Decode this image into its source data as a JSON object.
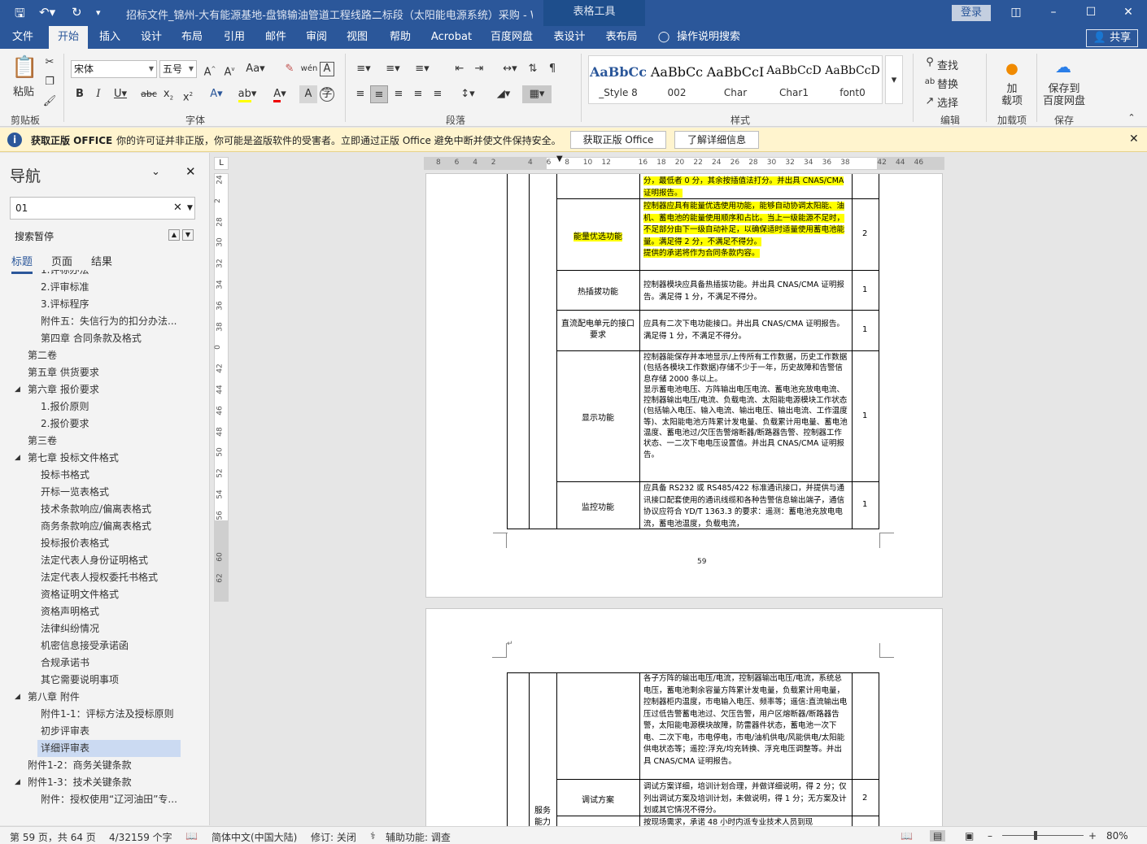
{
  "titlebar": {
    "document_title": "招标文件_锦州-大有能源基地-盘锦输油管道工程线路二标段（太阳能电源系统）采购 - W...",
    "context_tab": "表格工具",
    "login_label": "登录"
  },
  "tabs": [
    "文件",
    "开始",
    "插入",
    "设计",
    "布局",
    "引用",
    "邮件",
    "审阅",
    "视图",
    "帮助",
    "Acrobat",
    "百度网盘",
    "表设计",
    "表布局"
  ],
  "active_tab": "开始",
  "tell_me": "操作说明搜索",
  "share_label": "共享",
  "ribbon": {
    "clipboard": {
      "paste": "粘贴",
      "label": "剪贴板"
    },
    "font": {
      "name": "宋体",
      "size": "五号",
      "label": "字体"
    },
    "paragraph": {
      "label": "段落"
    },
    "styles": {
      "label": "样式",
      "items": [
        {
          "preview": "AaBbCc",
          "name": "_Style 8",
          "accent": "#2b579a"
        },
        {
          "preview": "AaBbCc",
          "name": "002",
          "accent": "#111111"
        },
        {
          "preview": "AaBbCcI",
          "name": "Char",
          "accent": "#111111"
        },
        {
          "preview": "AaBbCcD",
          "name": "Char1",
          "accent": "#111111"
        },
        {
          "preview": "AaBbCcD",
          "name": "font0",
          "accent": "#111111"
        }
      ]
    },
    "editing": {
      "find": "查找",
      "replace": "替换",
      "select": "选择",
      "label": "编辑"
    },
    "addins": {
      "load": "加\n载项",
      "label": "加载项"
    },
    "save": {
      "save_to": "保存到\n百度网盘",
      "label": "保存"
    }
  },
  "notification": {
    "title": "获取正版 OFFICE",
    "message": "你的许可证并非正版，你可能是盗版软件的受害者。立即通过正版 Office 避免中断并使文件保持安全。",
    "btn_get": "获取正版 Office",
    "btn_learn": "了解详细信息"
  },
  "nav": {
    "title": "导航",
    "search_value": "01",
    "search_paused": "搜索暂停",
    "tabs": [
      "标题",
      "页面",
      "结果"
    ],
    "items": [
      {
        "text": "1.评标办法",
        "indent": 2
      },
      {
        "text": "2.评审标准",
        "indent": 2
      },
      {
        "text": "3.评标程序",
        "indent": 2
      },
      {
        "text": "附件五：失信行为的扣分办法...",
        "indent": 2
      },
      {
        "text": "第四章  合同条款及格式",
        "indent": 2
      },
      {
        "text": "第二卷",
        "indent": 1
      },
      {
        "text": "第五章  供货要求",
        "indent": 1
      },
      {
        "text": "第六章  报价要求",
        "indent": 1,
        "arrow": true
      },
      {
        "text": "1.报价原则",
        "indent": 2
      },
      {
        "text": "2.报价要求",
        "indent": 2
      },
      {
        "text": "第三卷",
        "indent": 1
      },
      {
        "text": "第七章  投标文件格式",
        "indent": 1,
        "arrow": true
      },
      {
        "text": "投标书格式",
        "indent": 2
      },
      {
        "text": "开标一览表格式",
        "indent": 2
      },
      {
        "text": "技术条款响应/偏离表格式",
        "indent": 2
      },
      {
        "text": "商务条款响应/偏离表格式",
        "indent": 2
      },
      {
        "text": "投标报价表格式",
        "indent": 2
      },
      {
        "text": "法定代表人身份证明格式",
        "indent": 2
      },
      {
        "text": "法定代表人授权委托书格式",
        "indent": 2
      },
      {
        "text": "资格证明文件格式",
        "indent": 2
      },
      {
        "text": "资格声明格式",
        "indent": 2
      },
      {
        "text": "法律纠纷情况",
        "indent": 2
      },
      {
        "text": "机密信息接受承诺函",
        "indent": 2
      },
      {
        "text": "合规承诺书",
        "indent": 2
      },
      {
        "text": "其它需要说明事项",
        "indent": 2
      },
      {
        "text": "第八章  附件",
        "indent": 1,
        "arrow": true
      },
      {
        "text": "附件1-1：评标方法及授标原则",
        "indent": 2
      },
      {
        "text": "初步评审表",
        "indent": 2
      },
      {
        "text": "详细评审表",
        "indent": 2,
        "selected": true
      },
      {
        "text": "附件1-2：商务关键条款",
        "indent": 1
      },
      {
        "text": "附件1-3：技术关键条款",
        "indent": 1,
        "arrow": true
      },
      {
        "text": "附件：授权使用“辽河油田”专...",
        "indent": 2
      }
    ]
  },
  "ruler": {
    "h_numbers": [
      "8",
      "6",
      "4",
      "2",
      "",
      "4",
      "6",
      "8",
      "10",
      "12",
      "",
      "16",
      "18",
      "20",
      "22",
      "24",
      "26",
      "28",
      "30",
      "32",
      "34",
      "36",
      "38",
      "",
      "42",
      "44",
      "46"
    ],
    "v_numbers": [
      "24",
      "2",
      "28",
      "30",
      "32",
      "34",
      "36",
      "38",
      "0",
      "42",
      "44",
      "46",
      "48",
      "50",
      "52",
      "54",
      "56",
      "",
      "60",
      "62"
    ]
  },
  "page1": {
    "top_cont": "分，最低者 0 分，其余按插值法打分。并出具 CNAS/CMA 证明报告。",
    "rows": [
      {
        "label": "能量优选功能",
        "text": "控制器应具有能量优选使用功能，能够自动协调太阳能、油机、蓄电池的能量使用顺序和占比。当上一级能源不足时，不足部分由下一级自动补足，以确保适时适量使用蓄电池能量。满足得 2 分，不满足不得分。\n提供的承诺将作为合同条款内容。",
        "score": "2",
        "highlight": true
      },
      {
        "label": "热插拔功能",
        "text": "控制器模块应具备热插拔功能。并出具 CNAS/CMA 证明报告。满足得 1 分，不满足不得分。",
        "score": "1"
      },
      {
        "label": "直流配电单元的接口要求",
        "text": "应具有二次下电功能接口。并出具 CNAS/CMA 证明报告。满足得 1 分，不满足不得分。",
        "score": "1"
      },
      {
        "label": "显示功能",
        "text": "控制器能保存并本地显示/上传所有工作数据，历史工作数据(包括各模块工作数据)存储不少于一年，历史故障和告警信息存储 2000 条以上。\n显示蓄电池电压、方阵输出电压电流、蓄电池充放电电流、控制器输出电压/电流、负载电流、太阳能电源模块工作状态(包括输入电压、输入电流、输出电压、输出电流、工作温度等)、太阳能电池方阵累计发电量、负载累计用电量、蓄电池温度、蓄电池过/欠压告警熔断器/断路器告警、控制器工作状态、一二次下电电压设置值。并出具 CNAS/CMA 证明报告。",
        "score": "1"
      },
      {
        "label": "监控功能",
        "text": "应具备 RS232 或 RS485/422 标准通讯接口，并提供与通讯接口配套使用的通讯线缆和各种告警信息输出端子，通信协议应符合 YD/T 1363.3 的要求：遥测：蓄电池充放电电流，蓄电池温度，负载电流，",
        "score": "1"
      }
    ],
    "page_number": "59"
  },
  "page2": {
    "rows": [
      {
        "label": "",
        "text": "各子方阵的输出电压/电流，控制器输出电压/电流，系统总电压，蓄电池剩余容量方阵累计发电量，负载累计用电量，控制器柜内温度，市电输入电压、频率等；遥信:直流输出电压过低告警蓄电池过、欠压告警，用户区熔断器/断路器告警，太阳能电源模块故障，防雷器件状态，蓄电池一次下电、二次下电，市电停电，市电/油机供电/风能供电/太阳能供电状态等；遥控:浮充/均充转换、浮充电压调整等。并出具 CNAS/CMA 证明报告。",
        "score": ""
      },
      {
        "label": "调试方案",
        "text": "调试方案详细，培训计划合理，并做详细说明，得 2 分；仅列出调试方案及培训计划，未做说明，得 1 分；无方案及计划或其它情况不得分。",
        "score": "2"
      },
      {
        "label": "",
        "text": "按现场需求，承诺 48 小时内派专业技术人员到现",
        "score": ""
      }
    ],
    "side_label": "服务\n能力"
  },
  "status": {
    "page": "第 59 页，共 64 页",
    "words": "4/32159 个字",
    "language": "简体中文(中国大陆)",
    "revision": "修订: 关闭",
    "accessibility": "辅助功能: 调查",
    "zoom": "80%"
  }
}
